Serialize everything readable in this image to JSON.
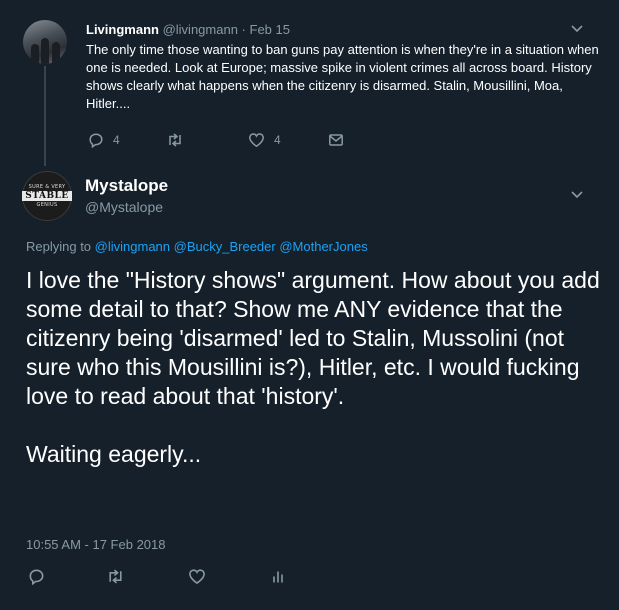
{
  "parent_tweet": {
    "name": "Livingmann",
    "handle": "@livingmann",
    "separator": "·",
    "date": "Feb 15",
    "text": "The only time those wanting to ban guns pay attention is when they're in a situation when one is needed. Look at Europe; massive spike in violent crimes all across board. History shows clearly what happens when the citizenry is disarmed. Stalin, Mousillini, Moa, Hitler....",
    "reply_count": "4",
    "like_count": "4"
  },
  "main_tweet": {
    "avatar_text": {
      "top": "SURE & VERY",
      "mid": "STABLE",
      "bottom": "GENIUS"
    },
    "name": "Mystalope",
    "handle": "@Mystalope",
    "replying_label": "Replying to",
    "mentions": [
      "@livingmann",
      "@Bucky_Breeder",
      "@MotherJones"
    ],
    "text_paragraph_1": "I love the \"History shows\" argument. How about you add some detail to that? Show me ANY evidence that the citizenry being 'disarmed' led to Stalin, Mussolini (not sure who this Mousillini is?), Hitler, etc. I would fucking love to read about that 'history'.",
    "text_paragraph_2": "Waiting eagerly...",
    "timestamp": "10:55 AM - 17 Feb 2018"
  },
  "icons": {
    "reply": "reply-icon",
    "retweet": "retweet-icon",
    "like": "heart-icon",
    "dm": "envelope-icon",
    "analytics": "analytics-icon",
    "menu": "chevron-down-icon"
  },
  "colors": {
    "background": "#15202b",
    "text": "#ffffff",
    "muted": "#8899a6",
    "link": "#1da1f2",
    "line": "#38444d"
  }
}
